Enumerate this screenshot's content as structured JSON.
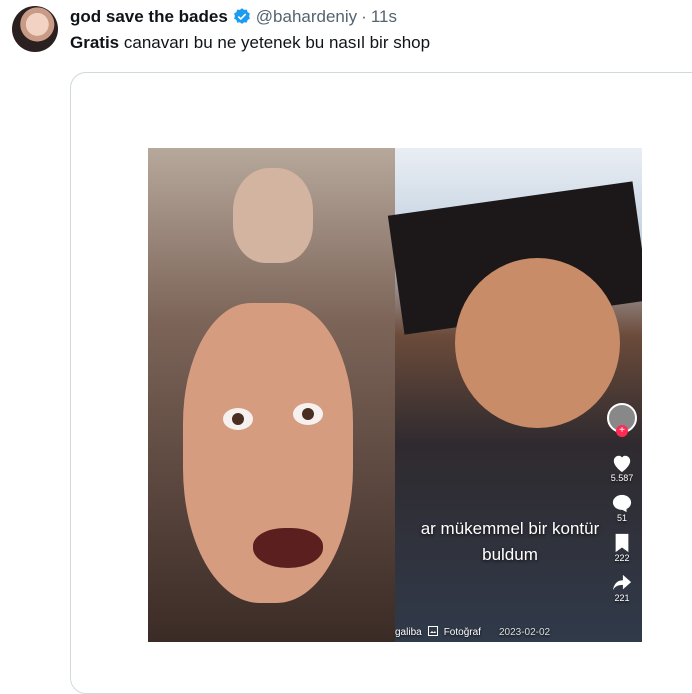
{
  "tweet": {
    "display_name": "god save the bades",
    "handle": "@bahardeniy",
    "separator": "·",
    "time": "11s",
    "text_bold": "Gratis",
    "text_rest": " canavarı bu ne yetenek bu nasıl bir shop"
  },
  "media": {
    "caption_line1": "ar mükemmel bir kontür",
    "caption_line2": "buldum",
    "likes": "5.587",
    "comments": "51",
    "saves": "222",
    "shares": "221",
    "creator_partial": "galiba",
    "photo_label": "Fotoğraf",
    "date": "2023-02-02"
  },
  "colors": {
    "verified": "#1d9bf0",
    "text": "#0f1419",
    "secondary": "#536471",
    "border": "#cfd9de"
  },
  "icons": [
    "verified-badge-icon",
    "heart-icon",
    "comment-icon",
    "bookmark-icon",
    "share-icon",
    "photo-icon"
  ]
}
